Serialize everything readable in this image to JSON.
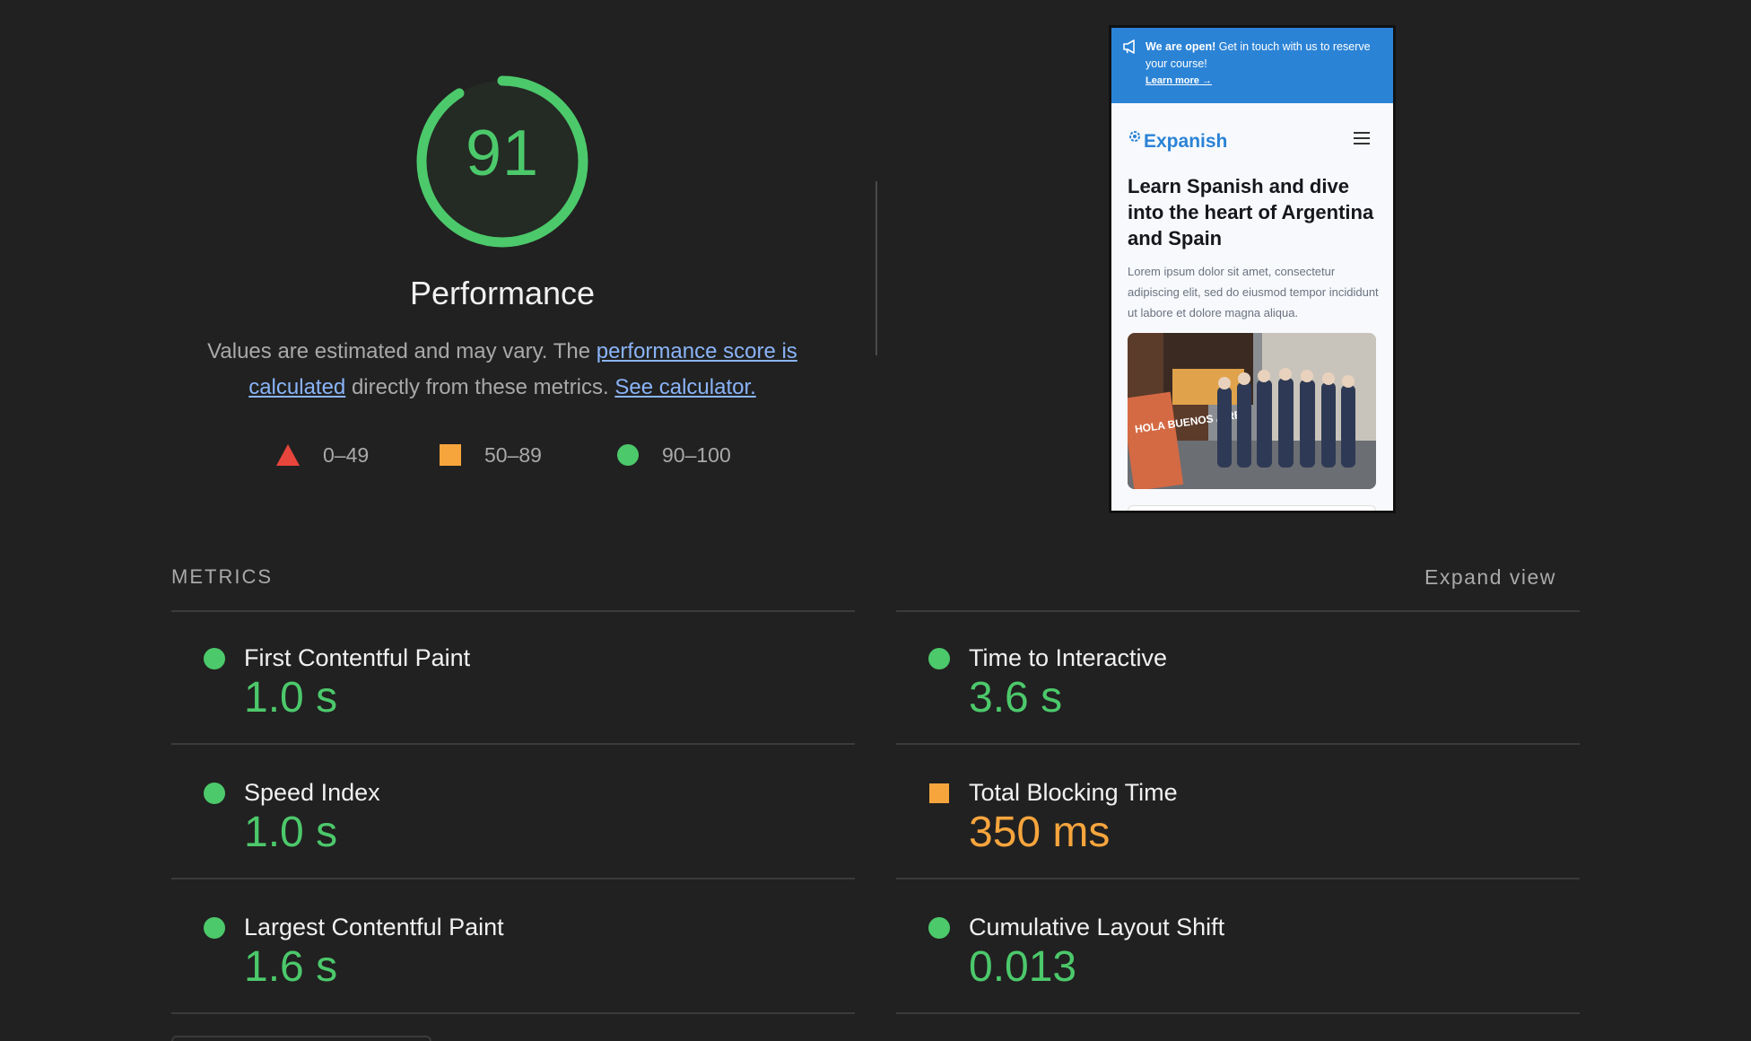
{
  "gauge": {
    "score": "91",
    "score_value": 91,
    "title": "Performance",
    "color": "#4cc96b"
  },
  "description": {
    "text_1": "Values are estimated and may vary. The ",
    "link_1": "performance score is calculated",
    "text_2": " directly from these metrics. ",
    "link_2": "See calculator."
  },
  "legend": [
    {
      "icon": "triangle-fail-icon",
      "label": "0–49",
      "color": "#e8453c"
    },
    {
      "icon": "square-average-icon",
      "label": "50–89",
      "color": "#f6a53d"
    },
    {
      "icon": "circle-pass-icon",
      "label": "90–100",
      "color": "#4cc96b"
    }
  ],
  "screenshot": {
    "banner_bold": "We are open!",
    "banner_text": " Get in touch with us to reserve your course!",
    "banner_link": "Learn more",
    "brand": "Expanish",
    "hero_title": "Learn Spanish and dive into the heart of Argentina and Spain",
    "hero_text": "Lorem ipsum dolor sit amet, consectetur adipiscing elit, sed do eiusmod tempor incididunt ut labore et dolore magna aliqua.",
    "photo_sign": "HOLA BUENOS AIRES",
    "accent_color": "#2b83d6"
  },
  "metrics": {
    "label": "METRICS",
    "expand_label": "Expand view",
    "items": [
      {
        "name": "First Contentful Paint",
        "value": "1.0 s",
        "status": "pass"
      },
      {
        "name": "Time to Interactive",
        "value": "3.6 s",
        "status": "pass"
      },
      {
        "name": "Speed Index",
        "value": "1.0 s",
        "status": "pass"
      },
      {
        "name": "Total Blocking Time",
        "value": "350 ms",
        "status": "average"
      },
      {
        "name": "Largest Contentful Paint",
        "value": "1.6 s",
        "status": "pass"
      },
      {
        "name": "Cumulative Layout Shift",
        "value": "0.013",
        "status": "pass"
      }
    ]
  }
}
